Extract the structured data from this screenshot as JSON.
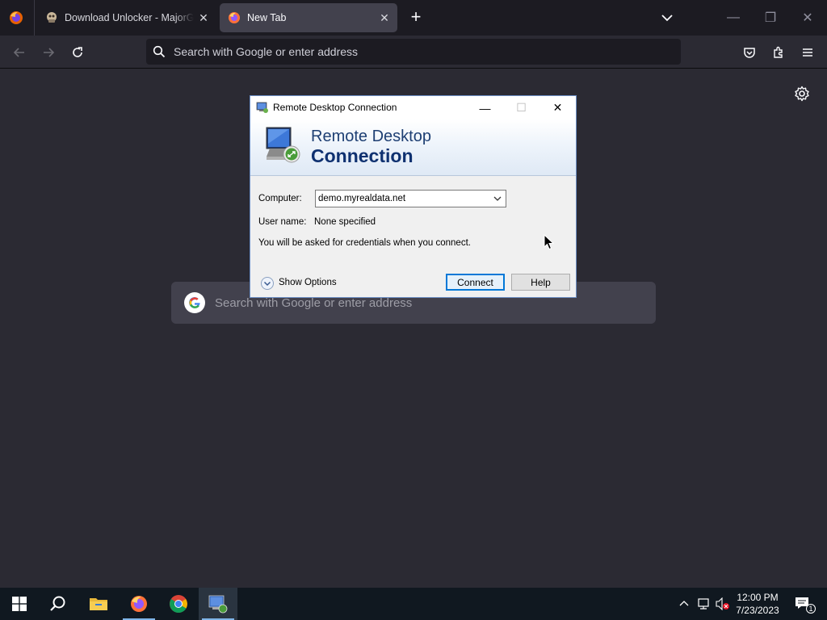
{
  "browser": {
    "tabs": [
      {
        "title": "Download Unlocker - MajorGeeks",
        "close": "✕"
      },
      {
        "title": "New Tab",
        "close": "✕"
      }
    ],
    "new_tab_symbol": "+",
    "window_controls": {
      "minimize": "—",
      "restore": "❐",
      "close": "✕"
    },
    "urlbar": {
      "placeholder": "Search with Google or enter address"
    }
  },
  "newtab_page": {
    "search_placeholder": "Search with Google or enter address"
  },
  "rdp_dialog": {
    "title": "Remote Desktop Connection",
    "banner_line1": "Remote Desktop",
    "banner_line2": "Connection",
    "computer_label": "Computer:",
    "computer_value": "demo.myrealdata.net",
    "username_label": "User name:",
    "username_value": "None specified",
    "info_text": "You will be asked for credentials when you connect.",
    "show_options_label": "Show Options",
    "connect_label": "Connect",
    "help_label": "Help",
    "controls": {
      "minimize": "—",
      "maximize": "☐",
      "close": "✕"
    }
  },
  "taskbar": {
    "time": "12:00 PM",
    "date": "7/23/2023",
    "notification_count": "1"
  },
  "colors": {
    "toolbar_bg": "#2b2a33",
    "tabstrip_bg": "#1c1b22",
    "active_tab": "#42414d",
    "dialog_accent": "#0078d7",
    "taskbar_bg": "#101820"
  }
}
